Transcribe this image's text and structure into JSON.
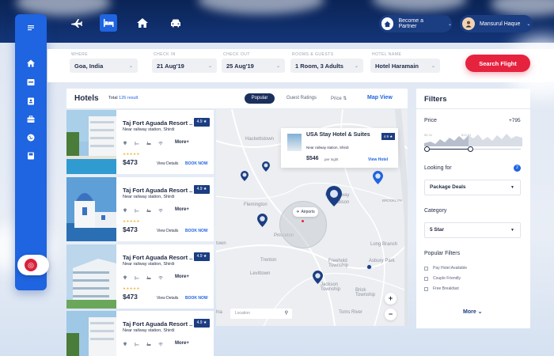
{
  "nav": {
    "partner_label": "Become a Partner",
    "user_name": "Mansurul Haque",
    "tabs": [
      "flights-icon",
      "hotels-icon",
      "home-icon",
      "car-icon"
    ]
  },
  "sidebar": {
    "items": [
      "home-icon",
      "inbox-icon",
      "contact-icon",
      "briefcase-icon",
      "globe-icon",
      "save-icon"
    ]
  },
  "search": {
    "where_label": "WHERE",
    "where_value": "Goa, India",
    "checkin_label": "CHECK IN",
    "checkin_value": "21 Aug'19",
    "checkout_label": "CHECK OUT",
    "checkout_value": "25 Aug'19",
    "rooms_label": "ROOMS & GUESTS",
    "rooms_value": "1 Room, 3 Adults",
    "hotel_label": "HOTEL NAME",
    "hotel_value": "Hotel Haramain",
    "button_label": "Search  Flight"
  },
  "hotels": {
    "title": "Hotels",
    "total_prefix": "Total",
    "total_count": "126 result",
    "tabs": {
      "popular": "Popular",
      "guest": "Guest Ratings",
      "price": "Price ⇅",
      "map": "Map View"
    },
    "cards": [
      {
        "name": "Taj Fort Aguada Resort ..",
        "location": "Near railway station, Shirdi",
        "rating": "4.9 ★",
        "more": "More+",
        "stars": "★★★★★",
        "price": "$473",
        "details": "View Details",
        "book": "BOOK NOW"
      },
      {
        "name": "Taj Fort Aguada Resort ..",
        "location": "Near railway station, Shirdi",
        "rating": "4.9 ★",
        "more": "More+",
        "stars": "★★★★★",
        "price": "$473",
        "details": "View Details",
        "book": "BOOK NOW"
      },
      {
        "name": "Taj Fort Aguada Resort ..",
        "location": "Near railway station, Shirdi",
        "rating": "4.9 ★",
        "more": "More+",
        "stars": "★★★★★",
        "price": "$473",
        "details": "View Details",
        "book": "BOOK NOW"
      },
      {
        "name": "Taj Fort Aguada Resort ..",
        "location": "Near railway station, Shirdi",
        "rating": "4.9 ★",
        "more": "More+"
      }
    ]
  },
  "map": {
    "labels": [
      "Hackettstown",
      "Flemington",
      "Piscataway",
      "Edison",
      "BROOKLYN",
      "Princeton",
      "Trenton",
      "Freehold Township",
      "Asbury Park",
      "Levittown",
      "Jackson Township",
      "Long Branch",
      "Brick Township",
      "Toms River",
      "hia",
      "town"
    ],
    "popup": {
      "title": "USA Stay Hotel & Suites",
      "location": "Near railway station, Shirdi",
      "rating": "4.9 ★",
      "price": "$546",
      "per": "per night",
      "view": "View Hotel"
    },
    "airport": "Airports",
    "search_placeholder": "Location",
    "zoom_in": "+",
    "zoom_out": "−"
  },
  "filters": {
    "title": "Filters",
    "price_label": "Price",
    "price_range": "+795",
    "price_min": "$5.34",
    "price_mid": "$19.54",
    "looking_label": "Looking for",
    "looking_count": "2",
    "looking_value": "Package Deals",
    "category_label": "Category",
    "category_value": "5 Star",
    "popular_label": "Popular Filters",
    "checks": [
      "Pay Hotel Available",
      "Couple Friendly",
      "Free Breakfast"
    ],
    "more": "More ⌄"
  },
  "colors": {
    "brand": "#1f64e0",
    "navy": "#1b3d82",
    "accent": "#e6233f"
  }
}
